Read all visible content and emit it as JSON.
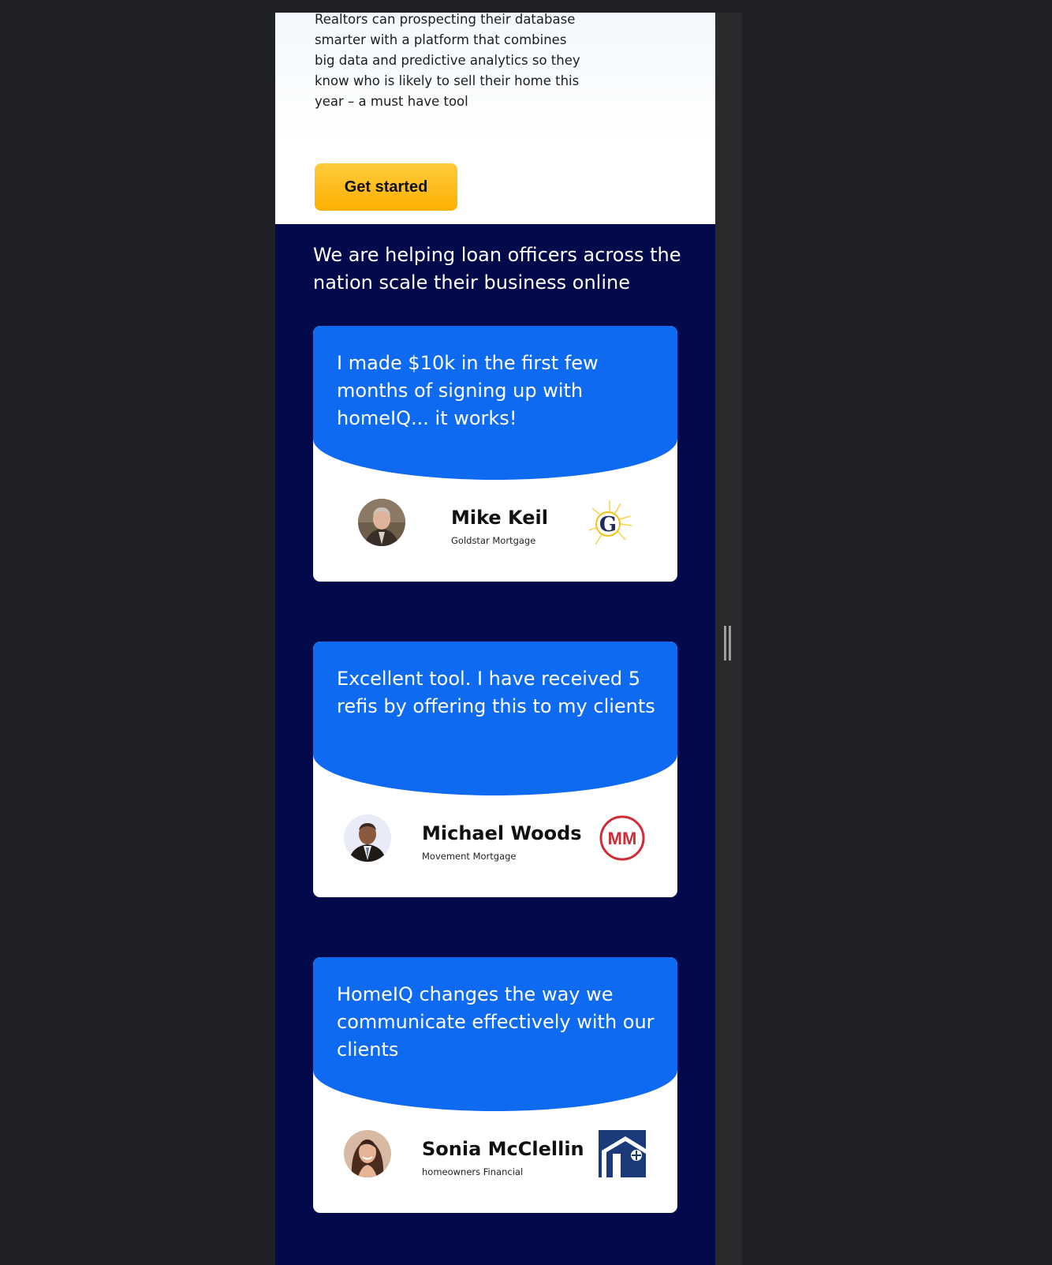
{
  "hero": {
    "description": "Realtors can prospecting their database smarter with a platform that combines big data and predictive analytics so they know who is likely to sell their home this year – a must have tool",
    "cta_label": "Get started"
  },
  "testimonials": {
    "heading": "We are helping loan officers across the nation scale their business online",
    "items": [
      {
        "quote": "I made $10k in the first few months of signing up with homeIQ... it works!",
        "name": "Mike Keil",
        "company": "Goldstar Mortgage",
        "logo_text": "G"
      },
      {
        "quote": "Excellent tool. I have received 5 refis by offering this to my clients",
        "name": "Michael Woods",
        "company": "Movement Mortgage",
        "logo_text": "MM"
      },
      {
        "quote": "HomeIQ changes the way we communicate effectively with our clients",
        "name": "Sonia McClellin",
        "company": "homeowners Financial",
        "logo_text": ""
      }
    ]
  },
  "colors": {
    "page_background": "#202124",
    "section_background": "#020a4b",
    "quote_blue": "#0e6af0",
    "cta_yellow": "#fbb000"
  }
}
